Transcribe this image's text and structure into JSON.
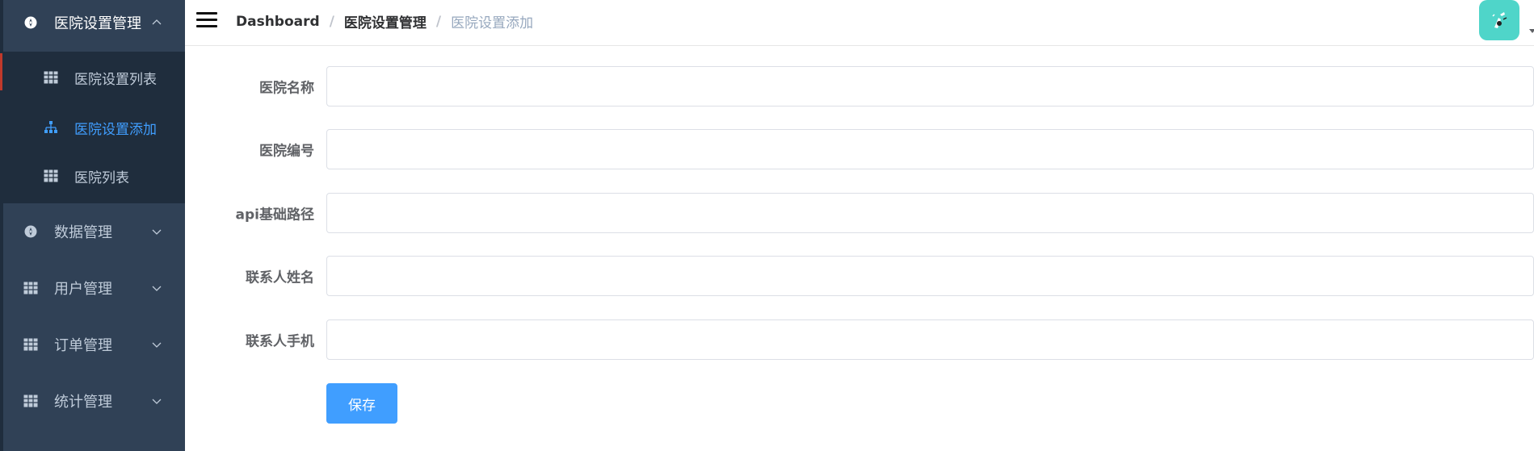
{
  "sidebar": {
    "menus": [
      {
        "label": "医院设置管理",
        "icon": "compass-icon",
        "open": true
      },
      {
        "label": "数据管理",
        "icon": "compass-icon",
        "open": false
      },
      {
        "label": "用户管理",
        "icon": "table-icon",
        "open": false
      },
      {
        "label": "订单管理",
        "icon": "table-icon",
        "open": false
      },
      {
        "label": "统计管理",
        "icon": "table-icon",
        "open": false
      }
    ],
    "submenu": [
      {
        "label": "医院设置列表",
        "icon": "table-icon",
        "active": false
      },
      {
        "label": "医院设置添加",
        "icon": "tree-icon",
        "active": true
      },
      {
        "label": "医院列表",
        "icon": "table-icon",
        "active": false
      }
    ]
  },
  "navbar": {
    "breadcrumb": [
      "Dashboard",
      "医院设置管理",
      "医院设置添加"
    ],
    "separator": "/",
    "avatar_icon": "user-avatar-icon"
  },
  "form": {
    "fields": [
      {
        "label": "医院名称",
        "value": "",
        "placeholder": ""
      },
      {
        "label": "医院编号",
        "value": "",
        "placeholder": ""
      },
      {
        "label": "api基础路径",
        "value": "",
        "placeholder": ""
      },
      {
        "label": "联系人姓名",
        "value": "",
        "placeholder": ""
      },
      {
        "label": "联系人手机",
        "value": "",
        "placeholder": ""
      }
    ],
    "save_label": "保存"
  },
  "colors": {
    "sidebar_bg": "#304156",
    "submenu_bg": "#1f2d3d",
    "active_text": "#409eff",
    "menu_text": "#bfcbd9",
    "primary_button": "#409eff",
    "avatar_bg": "#4fd5c9"
  }
}
